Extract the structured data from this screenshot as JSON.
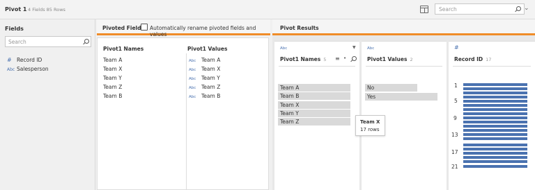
{
  "topbar": {
    "title": "Pivot 1",
    "meta": "4 Fields  85 Rows",
    "search_placeholder": "Search"
  },
  "fields_panel": {
    "title": "Fields",
    "search_placeholder": "Search",
    "items": [
      {
        "icon": "#",
        "label": "Record ID"
      },
      {
        "icon": "Abc",
        "label": "Salesperson"
      }
    ]
  },
  "pivoted_fields": {
    "title": "Pivoted Fields",
    "auto_rename_label": "Automatically rename pivoted fields and values",
    "auto_rename_checked": false,
    "names_header": "Pivot1 Names",
    "values_header": "Pivot1 Values",
    "rows": [
      {
        "name": "Team A",
        "value": "Team A"
      },
      {
        "name": "Team X",
        "value": "Team X"
      },
      {
        "name": "Team Y",
        "value": "Team Y"
      },
      {
        "name": "Team Z",
        "value": "Team Z"
      },
      {
        "name": "Team B",
        "value": "Team B"
      }
    ],
    "value_type": "Abc"
  },
  "results": {
    "title": "Pivot Results",
    "cards": [
      {
        "type": "Abc",
        "name": "Pivot1 Names",
        "count": "5",
        "bars": [
          {
            "label": "Team A",
            "fraction": 1.0
          },
          {
            "label": "Team B",
            "fraction": 1.0
          },
          {
            "label": "Team X",
            "fraction": 1.0
          },
          {
            "label": "Team Y",
            "fraction": 1.0
          },
          {
            "label": "Team Z",
            "fraction": 1.0
          }
        ]
      },
      {
        "type": "Abc",
        "name": "Pivot1 Values",
        "count": "2",
        "bars": [
          {
            "label": "No",
            "fraction": 0.72
          },
          {
            "label": "Yes",
            "fraction": 1.0
          }
        ]
      },
      {
        "type": "#",
        "name": "Record ID",
        "count": "17",
        "axis_labels": [
          "1",
          "5",
          "9",
          "13",
          "17",
          "21"
        ]
      }
    ],
    "tooltip": {
      "title": "Team X",
      "detail": "17 rows"
    }
  },
  "colors": {
    "accent": "#f08c28",
    "bar_fill": "#4a72b0",
    "bar_neutral": "#d9d9d9"
  }
}
